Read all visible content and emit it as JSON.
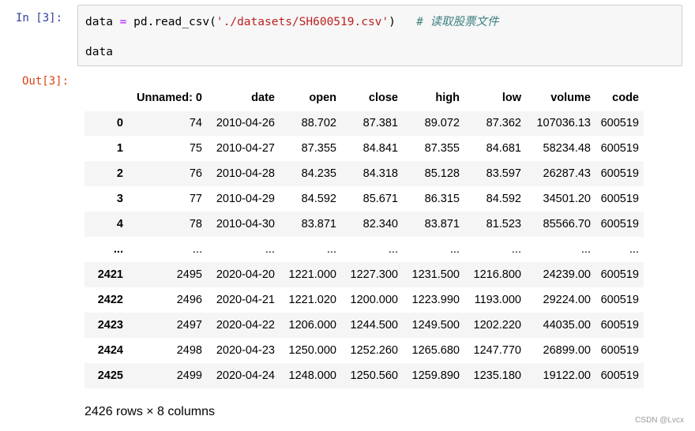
{
  "cell": {
    "input_prompt": "In  [3]:",
    "output_prompt": "Out[3]:",
    "code": {
      "line1": {
        "var": "data",
        "eq": "=",
        "call_open": "pd.read_csv(",
        "string": "'./datasets/SH600519.csv'",
        "call_close": ")",
        "comment": "# 读取股票文件"
      },
      "line2": "data"
    }
  },
  "table": {
    "columns": [
      "",
      "Unnamed: 0",
      "date",
      "open",
      "close",
      "high",
      "low",
      "volume",
      "code"
    ],
    "rows": [
      [
        "0",
        "74",
        "2010-04-26",
        "88.702",
        "87.381",
        "89.072",
        "87.362",
        "107036.13",
        "600519"
      ],
      [
        "1",
        "75",
        "2010-04-27",
        "87.355",
        "84.841",
        "87.355",
        "84.681",
        "58234.48",
        "600519"
      ],
      [
        "2",
        "76",
        "2010-04-28",
        "84.235",
        "84.318",
        "85.128",
        "83.597",
        "26287.43",
        "600519"
      ],
      [
        "3",
        "77",
        "2010-04-29",
        "84.592",
        "85.671",
        "86.315",
        "84.592",
        "34501.20",
        "600519"
      ],
      [
        "4",
        "78",
        "2010-04-30",
        "83.871",
        "82.340",
        "83.871",
        "81.523",
        "85566.70",
        "600519"
      ],
      [
        "...",
        "...",
        "...",
        "...",
        "...",
        "...",
        "...",
        "...",
        "..."
      ],
      [
        "2421",
        "2495",
        "2020-04-20",
        "1221.000",
        "1227.300",
        "1231.500",
        "1216.800",
        "24239.00",
        "600519"
      ],
      [
        "2422",
        "2496",
        "2020-04-21",
        "1221.020",
        "1200.000",
        "1223.990",
        "1193.000",
        "29224.00",
        "600519"
      ],
      [
        "2423",
        "2497",
        "2020-04-22",
        "1206.000",
        "1244.500",
        "1249.500",
        "1202.220",
        "44035.00",
        "600519"
      ],
      [
        "2424",
        "2498",
        "2020-04-23",
        "1250.000",
        "1252.260",
        "1265.680",
        "1247.770",
        "26899.00",
        "600519"
      ],
      [
        "2425",
        "2499",
        "2020-04-24",
        "1248.000",
        "1250.560",
        "1259.890",
        "1235.180",
        "19122.00",
        "600519"
      ]
    ],
    "summary": "2426 rows × 8 columns"
  },
  "watermark": "CSDN @Lvcx"
}
